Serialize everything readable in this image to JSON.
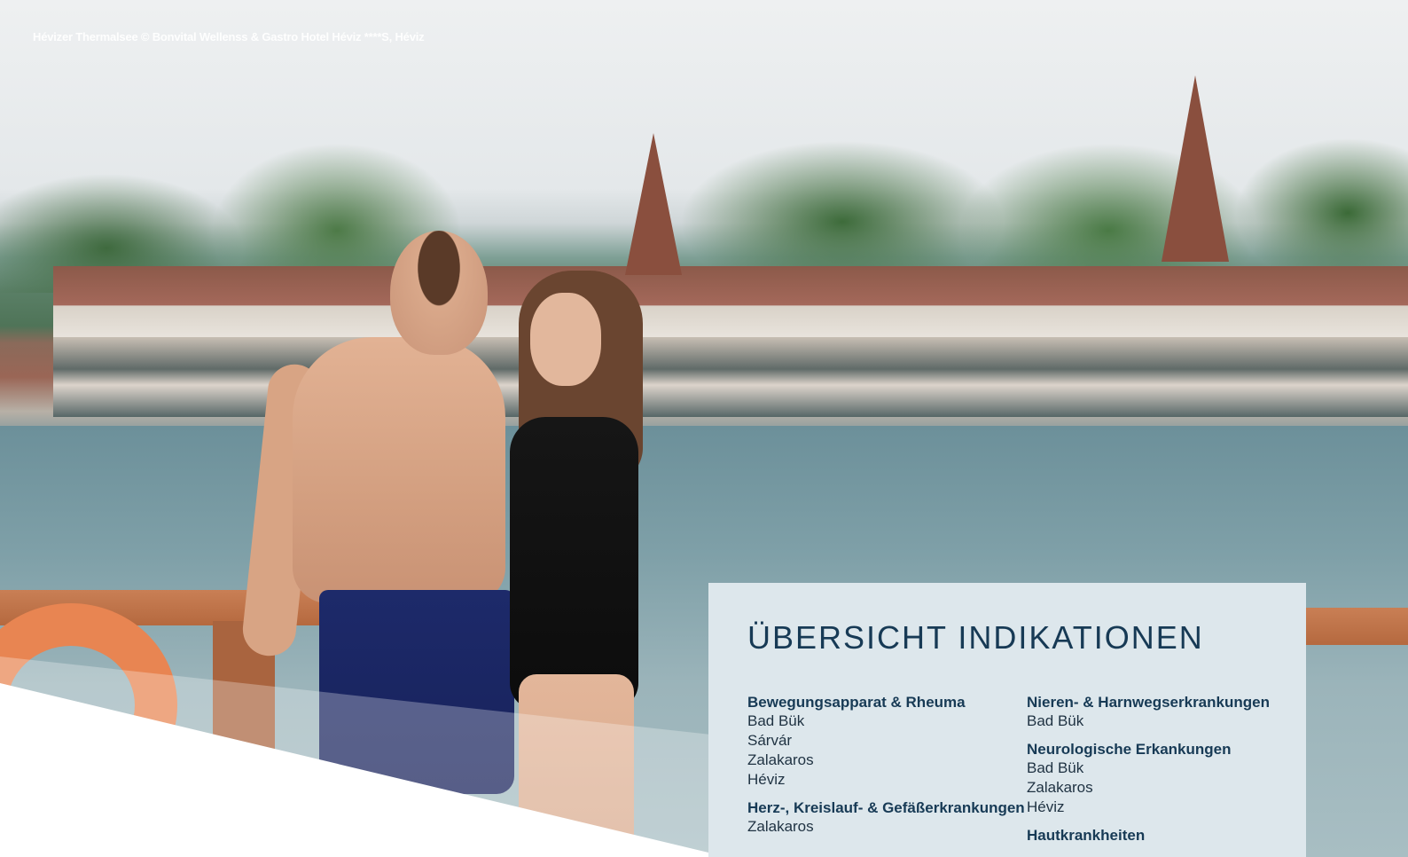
{
  "photo": {
    "credit": "Hévizer Thermalsee © Bonvital Wellenss & Gastro Hotel Héviz ****S, Héviz"
  },
  "panel": {
    "title": "ÜBERSICHT INDIKATIONEN",
    "left_column": [
      {
        "title": "Bewegungsapparat & Rheuma",
        "places": [
          "Bad Bük",
          "Sárvár",
          "Zalakaros",
          "Héviz"
        ]
      },
      {
        "title": "Herz-, Kreislauf- & Gefäßerkrankungen",
        "places": [
          "Zalakaros"
        ]
      }
    ],
    "right_column": [
      {
        "title": "Nieren- & Harnwegserkrankungen",
        "places": [
          "Bad Bük"
        ]
      },
      {
        "title": "Neurologische Erkankungen",
        "places": [
          "Bad Bük",
          "Zalakaros",
          "Héviz"
        ]
      },
      {
        "title": "Hautkrankheiten",
        "places": []
      }
    ]
  }
}
